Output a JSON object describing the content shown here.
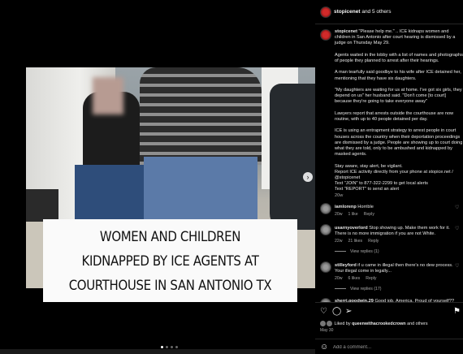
{
  "header": {
    "username": "stopicenet",
    "others_text": "and 5 others"
  },
  "post": {
    "caption_user": "stopicenet",
    "caption_body": "\"Please help me.\" .. ICE kidnaps women and children in San Antonio after court hearing is dismissed by a judge on Thursday May 29.\n\nAgents waited in the lobby with a list of names and photographs of people they planned to arrest after their hearings.\n\nA man tearfully said goodbye to his wife after ICE detained her, mentioning that they have six daughters.\n\n\"My daughters are waiting for us at home. I've got six girls, they depend on us\" her husband said. \"Don't come [to court] because they're going to take everyone away\"\n\nLawyers report that arrests outside the courthouse are now routine, with up to 40 people detained per day.\n\nICE is using an entrapment strategy to arrest people in court houses across the country when their deportation proceedings are dismissed by a judge. People are showing up to court doing what they are told, only to be ambushed and kidnapped by masked agents.\n\nStay aware, stay alert, be vigilant.\nReport ICE activity directly from your phone at stopice.net / @stopicenet\nText \"JOIN\" to 877-322-2299 to get local alerts\nText \"REPORT\" to send an alert",
    "caption_time": "20w",
    "image_caption_lines": [
      "WOMEN AND CHILDREN",
      "KIDNAPPED BY ICE AGENTS AT",
      "COURTHOUSE IN SAN ANTONIO TX"
    ],
    "next_glyph": "›"
  },
  "comments": [
    {
      "user": "iamlorenp",
      "text": "Horrible",
      "lines": [],
      "time": "20w",
      "likes": "1 like",
      "reply": "Reply",
      "heart": "♡"
    },
    {
      "user": "usarnyoverlord",
      "text": "Stop showing up. Make them work for it.",
      "lines": [
        "There is no more immigration if you are not White."
      ],
      "time": "22w",
      "likes": "21 likes",
      "reply": "Reply",
      "heart": "♡",
      "view_replies": "View replies (1)"
    },
    {
      "user": "stilleyford",
      "text": "if u came in illegal then there's no dew process.",
      "lines": [
        "Your illegal come in legally..."
      ],
      "time": "20w",
      "likes": "6 likes",
      "reply": "Reply",
      "heart": "♡",
      "view_replies": "View replies (17)"
    },
    {
      "user": "sherri.goodwin.29",
      "text": "Good job, America. Proud of yourself??",
      "lines": [],
      "time": "",
      "likes": "",
      "reply": "",
      "heart": "♡"
    }
  ],
  "actions": {
    "like_glyph": "♡",
    "comment_glyph": "◯",
    "share_glyph": "➢",
    "save_glyph": "⚑",
    "liked_by_prefix": "Liked by",
    "liked_by_user": "queenwithacrookedcrown",
    "liked_by_suffix": "and others",
    "date": "May 30"
  },
  "add_comment": {
    "placeholder": "Add a comment...",
    "emoji_glyph": "☺"
  },
  "colors": {
    "background": "#000000",
    "text": "#f5f5f5",
    "muted": "#a8a8a8",
    "caption_box": "#fafafa"
  }
}
